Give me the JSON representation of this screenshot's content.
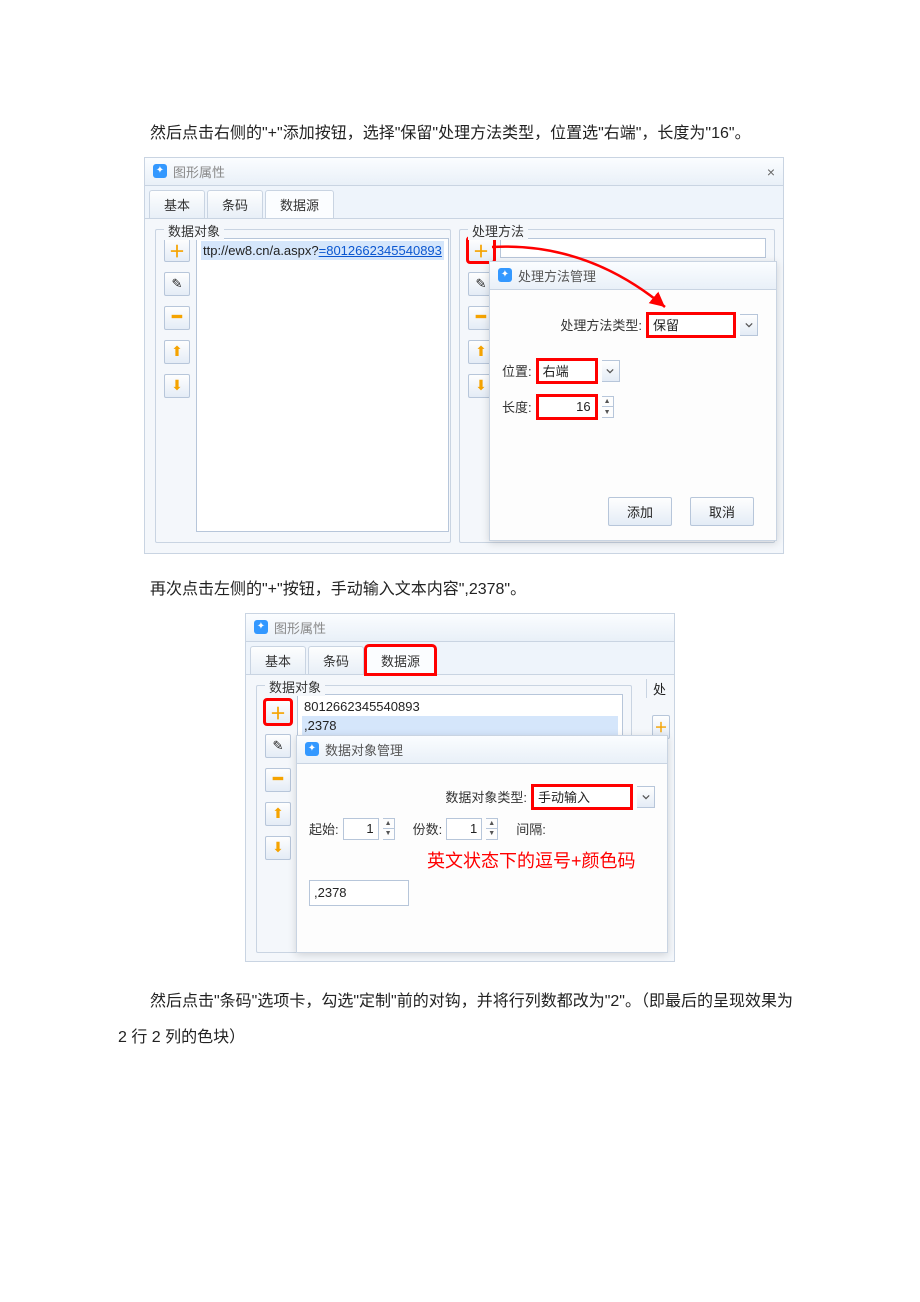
{
  "paragraphs": {
    "p1": "然后点击右侧的\"+\"添加按钮，选择\"保留\"处理方法类型，位置选\"右端\"，长度为\"16\"。",
    "p2": "再次点击左侧的\"+\"按钮，手动输入文本内容\",2378\"。",
    "p3": "然后点击\"条码\"选项卡，勾选\"定制\"前的对钩，并将行列数都改为\"2\"。（即最后的呈现效果为 2 行 2 列的色块）"
  },
  "fig1": {
    "title": "图形属性",
    "tabs": {
      "t1": "基本",
      "t2": "条码",
      "t3": "数据源"
    },
    "leftGroupLabel": "数据对象",
    "dataRow": {
      "prefix": "ttp://ew8.cn/a.aspx?",
      "link": "=8012662345540893"
    },
    "rightGroupLabel": "处理方法",
    "popupTitle": "处理方法管理",
    "typeLabel": "处理方法类型:",
    "typeValue": "保留",
    "posLabel": "位置:",
    "posValue": "右端",
    "lenLabel": "长度:",
    "lenValue": "16",
    "addBtn": "添加",
    "cancelBtn": "取消"
  },
  "fig2": {
    "title": "图形属性",
    "tabs": {
      "t1": "基本",
      "t2": "条码",
      "t3": "数据源"
    },
    "leftGroupLabel": "数据对象",
    "rightCutLabel": "处",
    "row1": "8012662345540893",
    "row2": ",2378",
    "popupTitle": "数据对象管理",
    "typeLabel": "数据对象类型:",
    "typeValue": "手动输入",
    "startLabel": "起始:",
    "startVal": "1",
    "copiesLabel": "份数:",
    "copiesVal": "1",
    "gapLabel": "间隔:",
    "note": "英文状态下的逗号+颜色码",
    "inputVal": ",2378"
  }
}
